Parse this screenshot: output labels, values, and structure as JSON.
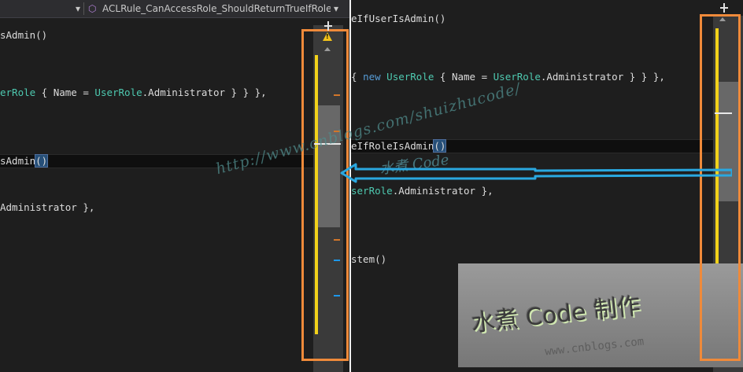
{
  "nav": {
    "dropdown_arrow": "▾",
    "method_icon": "cube-icon",
    "method_label": "ACLRule_CanAccessRole_ShouldReturnTrueIfRoleIs",
    "right_arrow": "▾"
  },
  "left_code": {
    "l1": "sAdmin()",
    "l2a": "erRole",
    "l2b": " { Name = ",
    "l2c": "UserRole",
    "l2d": ".Administrator } } },",
    "l3a": "sAdmin",
    "l3b": "()",
    "l4": "Administrator },"
  },
  "right_code": {
    "l1": "eIfUserIsAdmin()",
    "l2a": "{ ",
    "l2b": "new",
    "l2c": " ",
    "l2d": "UserRole",
    "l2e": " { Name = ",
    "l2f": "UserRole",
    "l2g": ".Administrator } } },",
    "l3a": "eIfRoleIsAdmin",
    "l3b": "()",
    "l4a": "serRole",
    "l4b": ".Administrator },",
    "l5": "stem()"
  },
  "watermark": {
    "url": "http://www.cnblogs.com/shuizhucode/",
    "brand": "水煮 Code",
    "overlay_brand": "水煮 Code 制作",
    "overlay_url": "www.cnblogs.com"
  },
  "colors": {
    "highlight_frame": "#ef8a3a",
    "scroll_indicator": "#f2d21a",
    "arrow": "#2aa8e0"
  }
}
